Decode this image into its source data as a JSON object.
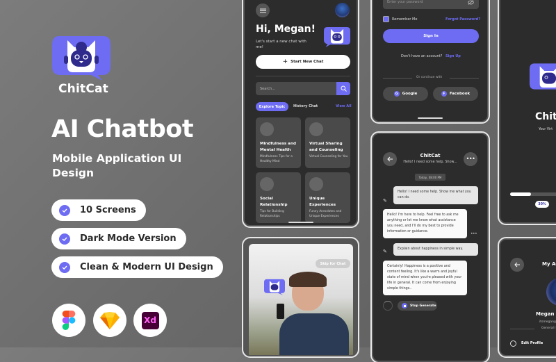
{
  "promo": {
    "brand": "ChitCat",
    "title": "AI Chatbot",
    "subtitle": "Mobile Application UI Design",
    "features": [
      "10 Screens",
      "Dark Mode Version",
      "Clean & Modern UI Design"
    ],
    "tools": [
      "figma-icon",
      "sketch-icon",
      "adobe-xd-icon"
    ],
    "xd_label": "Xd",
    "accent": "#6d6cf2"
  },
  "home_screen": {
    "greeting": "Hi, Megan!",
    "subgreeting": "Let's start a new chat with me!",
    "start_button": "Start New Chat",
    "search_placeholder": "Search...",
    "tabs": [
      "Explore Topic",
      "History Chat"
    ],
    "view_all": "View All",
    "cards": [
      {
        "title": "Mindfulness and Mental Health",
        "desc": "Mindfulness Tips for a Healthy Mind"
      },
      {
        "title": "Virtual Sharing and Counseling",
        "desc": "Virtual Counseling for You"
      },
      {
        "title": "Social Relationship",
        "desc": "Tips for Building Relationships"
      },
      {
        "title": "Unique Experiences",
        "desc": "Funny Anecdotes and Unique Experiences"
      }
    ]
  },
  "onboarding_screen": {
    "skip": "Skip for Chat"
  },
  "signin_screen": {
    "password_placeholder": "Enter your password",
    "remember": "Remember Me",
    "forgot": "Forgot Password?",
    "signin": "Sign In",
    "no_account": "Don't have an account?",
    "signup": "Sign Up",
    "or_continue": "Or continue with",
    "google": "Google",
    "google_letter": "G",
    "facebook": "Facebook",
    "facebook_letter": "F"
  },
  "chat_screen": {
    "title": "ChitCat",
    "subtitle": "Hello! I need some help. Show...",
    "timestamp": "Today, 08:00 PM",
    "messages": [
      {
        "from": "user",
        "text": "Hello! I need some help. Show me what you can do."
      },
      {
        "from": "bot",
        "text": "Hello! I'm here to help. Feel free to ask me anything or let me know what assistance you need, and I'll do my best to provide information or guidance."
      },
      {
        "from": "user",
        "text": "Explain about happiness in simple way."
      },
      {
        "from": "bot",
        "text": "Certainly! Happiness is a positive and content feeling. It's like a warm and joyful state of mind when you're pleased with your life in general. It can come from enjoying simple things.."
      }
    ],
    "stop_generate": "Stop Generate"
  },
  "splash_screen": {
    "brand": "Chit",
    "tagline": "Your Virt",
    "progress": 0.3,
    "progress_label": "30%"
  },
  "account_screen": {
    "title": "My Ac",
    "name": "Megan I",
    "handle": "itsmegang",
    "section": "General I",
    "edit_profile": "Edit Profile"
  }
}
